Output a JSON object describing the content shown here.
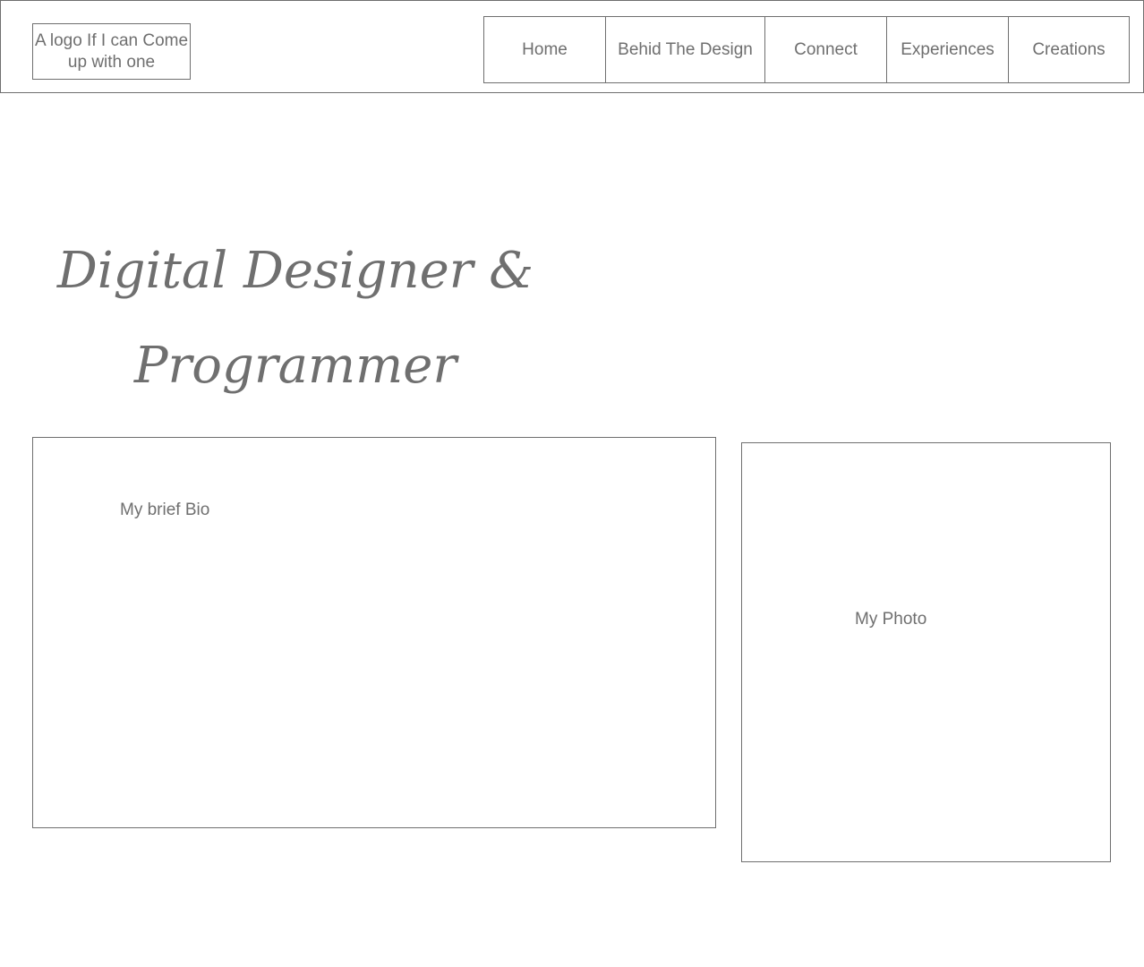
{
  "header": {
    "logo_text": "A logo If I can Come up with one",
    "nav": [
      "Home",
      "Behid The Design",
      "Connect",
      "Experiences",
      "Creations"
    ]
  },
  "hero": {
    "title_line1": "Digital Designer &",
    "title_line2": "Programmer"
  },
  "bio": {
    "label": "My brief Bio"
  },
  "photo": {
    "label": "My Photo"
  }
}
